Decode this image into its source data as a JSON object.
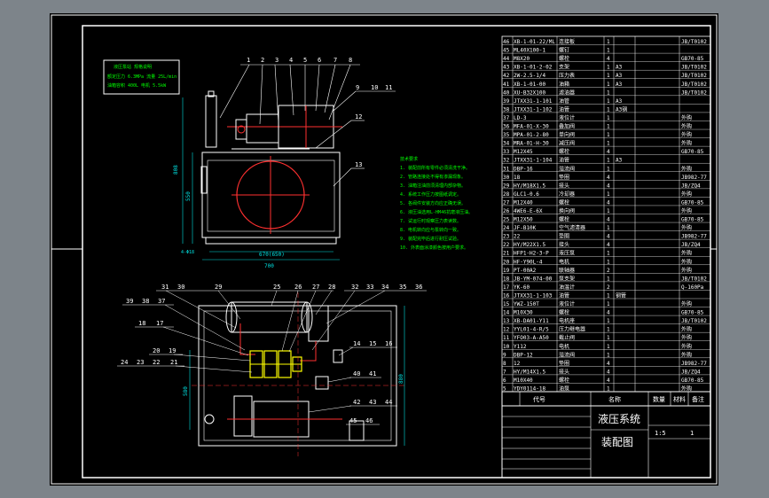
{
  "colors": {
    "background": "#7d848a",
    "sheet": "#000000",
    "outline": "#ffffff",
    "component": "#ff3030",
    "notes": "#00ff00",
    "dimension": "#00e0e0",
    "tank": "#ff00ff",
    "valve": "#ffff00",
    "label": "#ffffff"
  },
  "title_block": {
    "title_a": "液压系统",
    "title_b": "装配图",
    "col_code": "代号",
    "col_name": "名称",
    "col_qty": "数量",
    "col_material": "材料",
    "col_note": "备注",
    "scale": "1:5",
    "sheet": "1"
  },
  "front_view": {
    "leaders_top": [
      "1",
      "2",
      "3",
      "4",
      "5",
      "6",
      "7",
      "8"
    ],
    "leaders_right": [
      "9",
      "10",
      "11",
      "12",
      "13"
    ],
    "dim_width": "700",
    "dim_inner": "670(650)",
    "dim_height": "808",
    "dim_tank": "550",
    "dim_small": "4-Φ18"
  },
  "plan_view": {
    "leaders_top": [
      "31",
      "30",
      "29",
      "25",
      "26",
      "27",
      "28",
      "32",
      "33",
      "34",
      "35",
      "36"
    ],
    "leaders_left_a": [
      "39",
      "38",
      "37"
    ],
    "leaders_left_b": [
      "18",
      "17"
    ],
    "leaders_left_c": [
      "20",
      "19"
    ],
    "leaders_left_d": [
      "24",
      "23",
      "22",
      "21"
    ],
    "leaders_right_a": [
      "14",
      "15",
      "16"
    ],
    "leaders_right_b": [
      "40",
      "41"
    ],
    "leaders_right_c": [
      "42",
      "43",
      "44"
    ],
    "leaders_right_d": [
      "45",
      "46"
    ],
    "dim_height": "880",
    "dim_side": "580"
  },
  "notes_lines": [
    "技术要求",
    "1. 装配前所有零件必须清洗干净。",
    "2. 管路连接处不得有渗漏现象。",
    "3. 油箱注油前须清理内部杂物。",
    "4. 系统工作压力按图纸调定。",
    "5. 各阀件安装方向应正确无误。",
    "6. 液压油选用L-HM46抗磨液压油。",
    "7. 试运行时观察压力表读数。",
    "8. 电机转向应与泵转向一致。",
    "9. 装配完毕后进行耐压试验。",
    "10. 外表面涂漆颜色按用户要求。"
  ],
  "legend_box": [
    "液压泵站 规格说明",
    "额定压力 6.3MPa 流量 25L/min",
    "油箱容积 400L 电机 5.5kW"
  ],
  "parts": [
    {
      "no": "46",
      "code": "XB-1-01-22/ML",
      "name": "连接板",
      "qty": "1",
      "mat": "",
      "note": "JB/T0102"
    },
    {
      "no": "45",
      "code": "ML40X100-1",
      "name": "螺钉",
      "qty": "1",
      "mat": "",
      "note": ""
    },
    {
      "no": "44",
      "code": "M8X20",
      "name": "螺栓",
      "qty": "4",
      "mat": "",
      "note": "GB70-85"
    },
    {
      "no": "43",
      "code": "XB-1-01-2-02",
      "name": "支架",
      "qty": "1",
      "mat": "A3",
      "note": "JB/T0102"
    },
    {
      "no": "42",
      "code": "2W-2.5-1/4",
      "name": "压力表",
      "qty": "1",
      "mat": "A3",
      "note": "JB/T0102"
    },
    {
      "no": "41",
      "code": "XB-1-01-00",
      "name": "油箱",
      "qty": "1",
      "mat": "A3",
      "note": "JB/T0102"
    },
    {
      "no": "40",
      "code": "XU-B32X100",
      "name": "滤油器",
      "qty": "1",
      "mat": "",
      "note": "JB/T0102"
    },
    {
      "no": "39",
      "code": "JTXX31-1-101",
      "name": "油管",
      "qty": "1",
      "mat": "A3",
      "note": ""
    },
    {
      "no": "38",
      "code": "JTXX31-1-102",
      "name": "油管",
      "qty": "1",
      "mat": "A3钢",
      "note": ""
    },
    {
      "no": "37",
      "code": "LD-3",
      "name": "液位计",
      "qty": "1",
      "mat": "",
      "note": "外购"
    },
    {
      "no": "36",
      "code": "MFA-01-X-30",
      "name": "叠加阀",
      "qty": "1",
      "mat": "",
      "note": "外购"
    },
    {
      "no": "35",
      "code": "MPA-01-2-80",
      "name": "单向阀",
      "qty": "1",
      "mat": "",
      "note": "外购"
    },
    {
      "no": "34",
      "code": "MRA-01-H-30",
      "name": "减压阀",
      "qty": "1",
      "mat": "",
      "note": "外购"
    },
    {
      "no": "33",
      "code": "M12X45",
      "name": "螺栓",
      "qty": "4",
      "mat": "",
      "note": "GB70-85"
    },
    {
      "no": "32",
      "code": "JTXX31-1-104",
      "name": "油管",
      "qty": "1",
      "mat": "A3",
      "note": ""
    },
    {
      "no": "31",
      "code": "DBP-16",
      "name": "溢流阀",
      "qty": "1",
      "mat": "",
      "note": "外购"
    },
    {
      "no": "30",
      "code": "18",
      "name": "垫圈",
      "qty": "4",
      "mat": "",
      "note": "JB982-77"
    },
    {
      "no": "29",
      "code": "HY/M18X1.5",
      "name": "接头",
      "qty": "4",
      "mat": "",
      "note": "JB/ZQ4"
    },
    {
      "no": "28",
      "code": "GLC1-0.6",
      "name": "冷却器",
      "qty": "1",
      "mat": "",
      "note": "外购"
    },
    {
      "no": "27",
      "code": "M12X40",
      "name": "螺栓",
      "qty": "4",
      "mat": "",
      "note": "GB70-85"
    },
    {
      "no": "26",
      "code": "4WE6-E-6X",
      "name": "换向阀",
      "qty": "1",
      "mat": "",
      "note": "外购"
    },
    {
      "no": "25",
      "code": "M12X50",
      "name": "螺栓",
      "qty": "4",
      "mat": "",
      "note": "GB70-85"
    },
    {
      "no": "24",
      "code": "JF-B10K",
      "name": "空气滤清器",
      "qty": "1",
      "mat": "",
      "note": "外购"
    },
    {
      "no": "23",
      "code": "22",
      "name": "垫圈",
      "qty": "4",
      "mat": "",
      "note": "JB982-77"
    },
    {
      "no": "22",
      "code": "HY/M22X1.5",
      "name": "接头",
      "qty": "4",
      "mat": "",
      "note": "JB/ZQ4"
    },
    {
      "no": "21",
      "code": "HFP1-H2-3-P",
      "name": "液压泵",
      "qty": "1",
      "mat": "",
      "note": "外购"
    },
    {
      "no": "20",
      "code": "HF-Y90L-4",
      "name": "电机",
      "qty": "1",
      "mat": "",
      "note": "外购"
    },
    {
      "no": "19",
      "code": "PT-00A2",
      "name": "联轴器",
      "qty": "2",
      "mat": "",
      "note": "外购"
    },
    {
      "no": "18",
      "code": "JB-YM-074-00",
      "name": "泵支架",
      "qty": "1",
      "mat": "",
      "note": "JB/T0102"
    },
    {
      "no": "17",
      "code": "YK-60",
      "name": "油温计",
      "qty": "2",
      "mat": "",
      "note": "Q-160Pa"
    },
    {
      "no": "16",
      "code": "JTXX31-1-103",
      "name": "油管",
      "qty": "1",
      "mat": "钢管",
      "note": ""
    },
    {
      "no": "15",
      "code": "YWZ-150T",
      "name": "液位计",
      "qty": "1",
      "mat": "",
      "note": "外购"
    },
    {
      "no": "14",
      "code": "M10X30",
      "name": "螺栓",
      "qty": "4",
      "mat": "",
      "note": "GB70-85"
    },
    {
      "no": "13",
      "code": "XB-DA01-Y11",
      "name": "电机座",
      "qty": "1",
      "mat": "",
      "note": "JB/T0102"
    },
    {
      "no": "12",
      "code": "YYL01-4-R/5",
      "name": "压力继电器",
      "qty": "1",
      "mat": "",
      "note": "外购"
    },
    {
      "no": "11",
      "code": "YFO03-A-A50",
      "name": "截止阀",
      "qty": "1",
      "mat": "",
      "note": "外购"
    },
    {
      "no": "10",
      "code": "Y112",
      "name": "电机",
      "qty": "1",
      "mat": "",
      "note": "外购"
    },
    {
      "no": "9",
      "code": "DBP-12",
      "name": "溢流阀",
      "qty": "1",
      "mat": "",
      "note": "外购"
    },
    {
      "no": "8",
      "code": "12",
      "name": "垫圈",
      "qty": "4",
      "mat": "",
      "note": "JB982-77"
    },
    {
      "no": "7",
      "code": "HY/M14X1.5",
      "name": "接头",
      "qty": "4",
      "mat": "",
      "note": "JB/ZQ4"
    },
    {
      "no": "6",
      "code": "M10X40",
      "name": "螺栓",
      "qty": "4",
      "mat": "",
      "note": "GB70-85"
    },
    {
      "no": "5",
      "code": "YDY0114-18",
      "name": "油泵",
      "qty": "1",
      "mat": "",
      "note": "外购"
    }
  ]
}
